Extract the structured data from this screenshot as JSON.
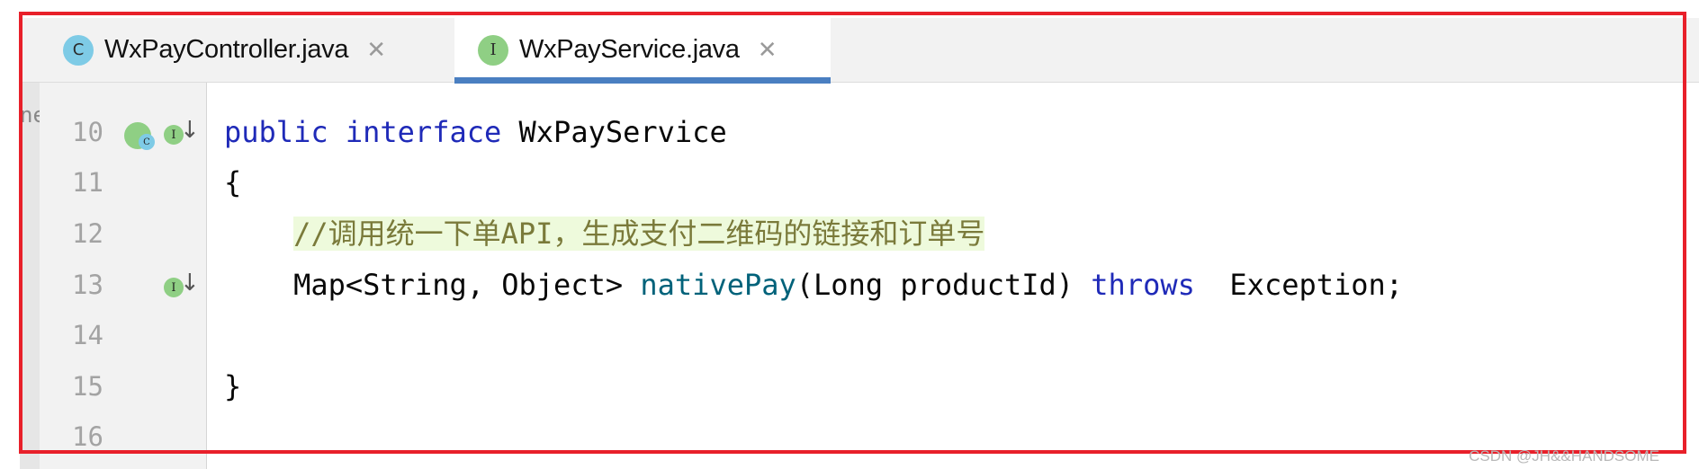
{
  "tabs": [
    {
      "label": "WxPayController.java",
      "icon": "class-icon",
      "icon_letter": "C",
      "icon_color": "#7ecbe6",
      "active": false
    },
    {
      "label": "WxPayService.java",
      "icon": "interface-icon",
      "icon_letter": "I",
      "icon_color": "#8fcf84",
      "active": true
    }
  ],
  "close_glyph": "✕",
  "side_fragment": "ne",
  "gutter": {
    "line_numbers": [
      "10",
      "11",
      "12",
      "13",
      "14",
      "15",
      "16"
    ],
    "implemented_badge_letter": "C",
    "interface_badge_letter": "I",
    "arrow_glyph": "↓"
  },
  "code": {
    "line10": {
      "kw1": "public",
      "kw2": "interface",
      "name": "WxPayService"
    },
    "line11": "{",
    "line12_comment": "//调用统一下单API，生成支付二维码的链接和订单号",
    "line13": {
      "type": "Map<String, Object>",
      "method": "nativePay",
      "params": "(Long productId)",
      "kw": "throws",
      "exc": "Exception;"
    },
    "line15": "}"
  },
  "colors": {
    "accent": "#4a7fc1",
    "keyword": "#1f2ab8",
    "method": "#00627a",
    "comment_bg": "#eefadc",
    "highlight_border": "#e8202a"
  },
  "watermark": "CSDN @JH&&HANDSOME"
}
